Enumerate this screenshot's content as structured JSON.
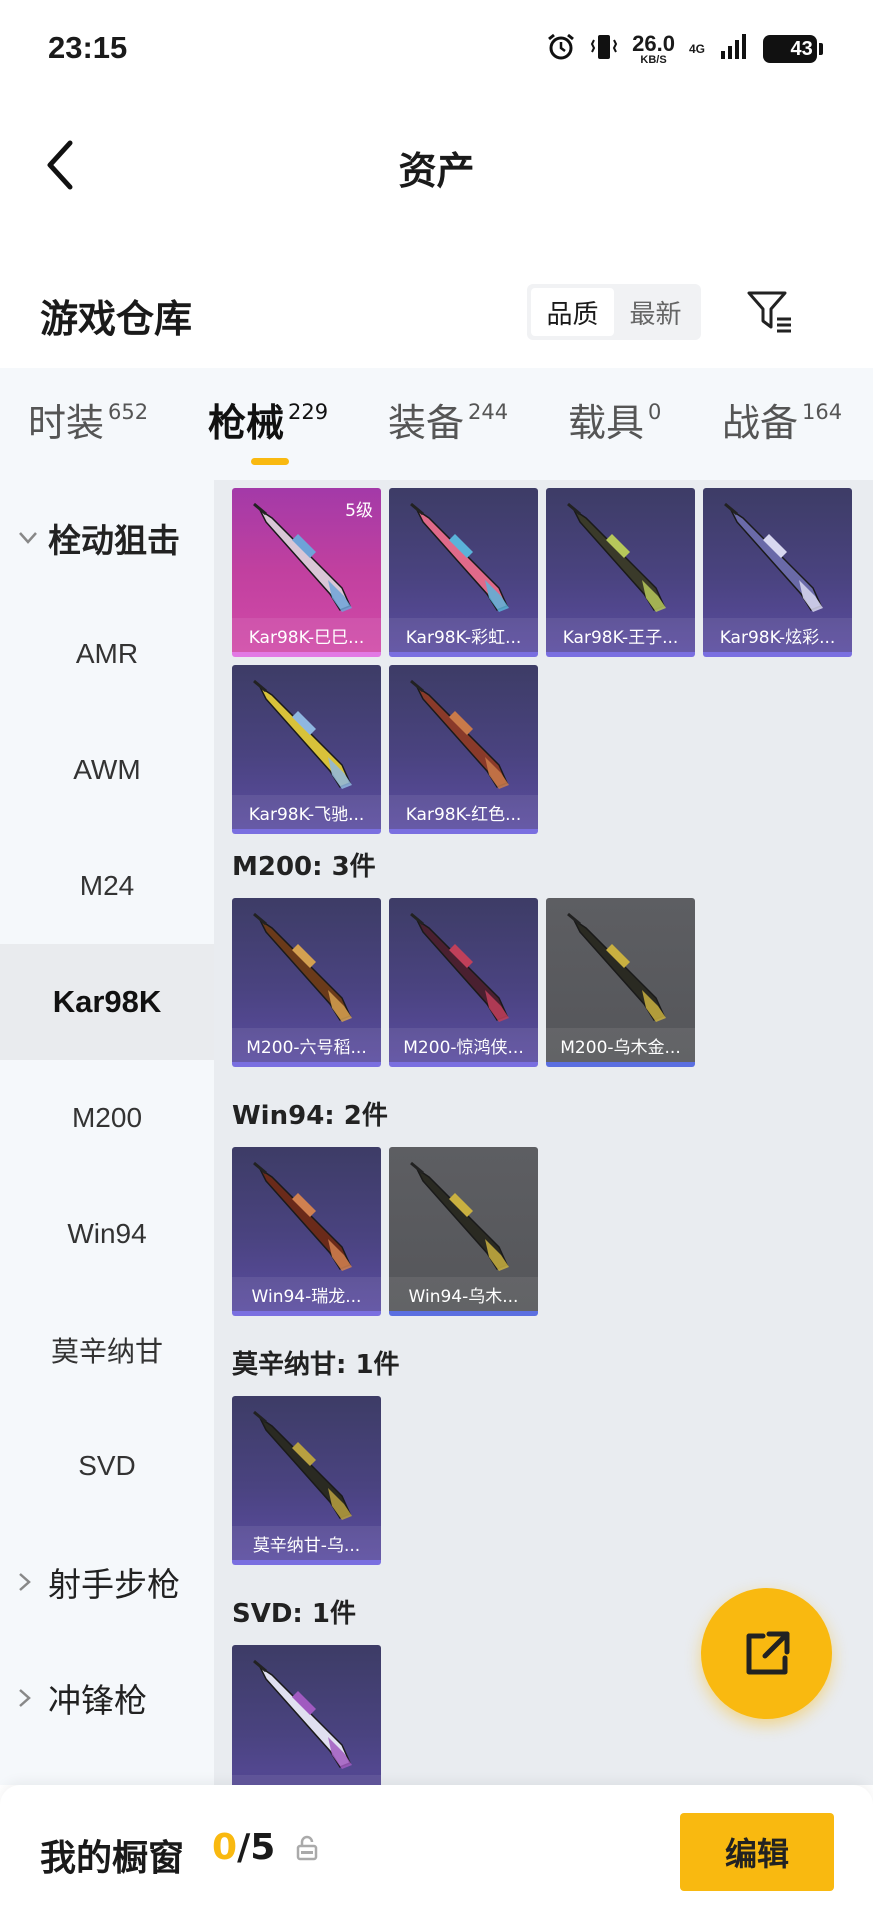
{
  "status_bar": {
    "time": "23:15",
    "net_speed": "26.0",
    "net_speed_unit": "KB/S",
    "network": "4G",
    "battery": "43",
    "battery_level": 0.43,
    "icons": [
      "alarm-icon",
      "vibrate-icon",
      "signal-icon",
      "battery-icon"
    ]
  },
  "header": {
    "title": "资产"
  },
  "section": {
    "title": "游戏仓库",
    "sort_options": [
      "品质",
      "最新"
    ],
    "sort_selected": "品质"
  },
  "tabs": [
    {
      "label": "时装",
      "count": "652"
    },
    {
      "label": "枪械",
      "count": "229",
      "active": true
    },
    {
      "label": "装备",
      "count": "244"
    },
    {
      "label": "载具",
      "count": "0"
    },
    {
      "label": "战备",
      "count": "164"
    }
  ],
  "sidebar": {
    "groups": [
      {
        "label": "栓动狙击",
        "expanded": true
      },
      {
        "label": "射手步枪",
        "expanded": false
      },
      {
        "label": "冲锋枪",
        "expanded": false
      }
    ],
    "items": [
      "AMR",
      "AWM",
      "M24",
      "Kar98K",
      "M200",
      "Win94",
      "莫辛纳甘",
      "SVD"
    ],
    "active": "Kar98K"
  },
  "content": {
    "kar98k_items": [
      {
        "name": "Kar98K-巳巳...",
        "level": "5级",
        "rarity": "pink"
      },
      {
        "name": "Kar98K-彩虹...",
        "rarity": "purple"
      },
      {
        "name": "Kar98K-王子...",
        "rarity": "purple"
      },
      {
        "name": "Kar98K-炫彩...",
        "rarity": "purple"
      },
      {
        "name": "Kar98K-飞驰...",
        "rarity": "purple"
      },
      {
        "name": "Kar98K-红色...",
        "rarity": "purple"
      }
    ],
    "m200": {
      "label": "M200: 3件",
      "items": [
        {
          "name": "M200-六号稻...",
          "rarity": "purple"
        },
        {
          "name": "M200-惊鸿侠...",
          "rarity": "purple"
        },
        {
          "name": "M200-乌木金...",
          "rarity": "gray"
        }
      ]
    },
    "win94": {
      "label": "Win94: 2件",
      "items": [
        {
          "name": "Win94-瑞龙...",
          "rarity": "purple"
        },
        {
          "name": "Win94-乌木...",
          "rarity": "gray"
        }
      ]
    },
    "mosin": {
      "label": "莫辛纳甘: 1件",
      "items": [
        {
          "name": "莫辛纳甘-乌...",
          "rarity": "purple"
        }
      ]
    },
    "svd": {
      "label": "SVD: 1件",
      "items": [
        {
          "name": "",
          "rarity": "purple"
        }
      ]
    }
  },
  "bottom_bar": {
    "title": "我的橱窗",
    "count_current": "0",
    "count_total": "/5",
    "edit_label": "编辑"
  },
  "colors": {
    "accent": "#f9b910",
    "sidebar_bg": "#f5f8fb",
    "content_bg": "#e9ecf0",
    "card_purple": "#4a4380",
    "card_pink": "#c1409f",
    "card_gray": "#57585c"
  }
}
